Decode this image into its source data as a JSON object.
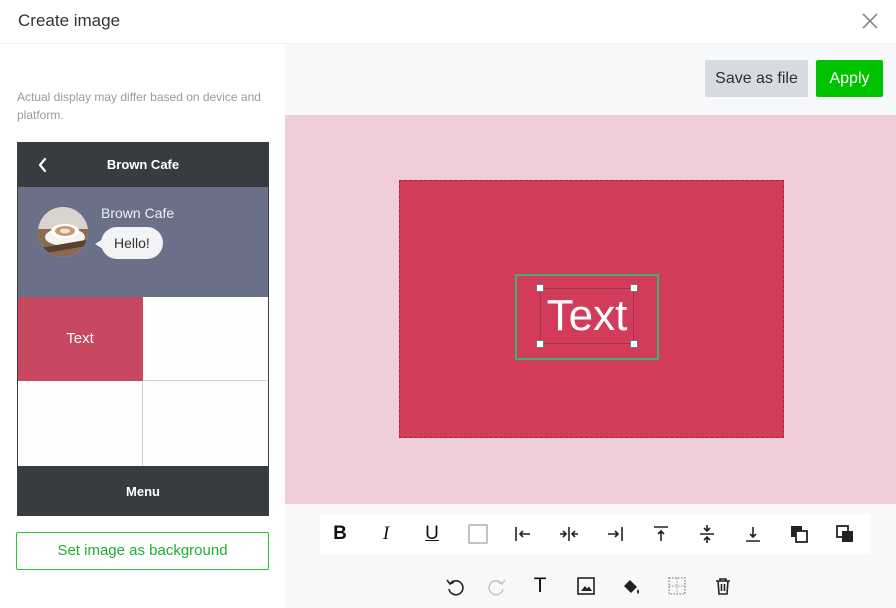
{
  "window": {
    "title": "Create image",
    "close_icon": "close-icon"
  },
  "left": {
    "notice": "Actual display may differ based on device and platform.",
    "preview": {
      "header_name": "Brown Cafe",
      "back_icon": "chevron-left-icon",
      "sender": "Brown Cafe",
      "message": "Hello!",
      "cell_text": "Text",
      "footer": "Menu"
    },
    "set_background_label": "Set image as background"
  },
  "actions": {
    "save_label": "Save as file",
    "apply_label": "Apply"
  },
  "canvas": {
    "text": "Text",
    "background_color": "#f0ced9",
    "artboard_color": "#d23c5a",
    "selection_color": "#3bb36a"
  },
  "toolbar_format": {
    "bold": "B",
    "italic": "I",
    "underline": "U",
    "tools": [
      "bold-icon",
      "italic-icon",
      "underline-icon",
      "color-swatch",
      "align-left-icon",
      "align-center-horizontal-icon",
      "align-right-icon",
      "align-top-icon",
      "align-middle-vertical-icon",
      "align-bottom-icon",
      "send-backward-icon",
      "bring-forward-icon"
    ]
  },
  "toolbar_edit": {
    "text_tool": "T",
    "tools": [
      "undo-icon",
      "redo-icon",
      "text-tool-icon",
      "image-tool-icon",
      "fill-bucket-icon",
      "transparency-grid-icon",
      "trash-icon"
    ]
  },
  "colors": {
    "accent": "#00c300",
    "phone_dark": "#383b40",
    "chat_bg": "#6a7087"
  }
}
